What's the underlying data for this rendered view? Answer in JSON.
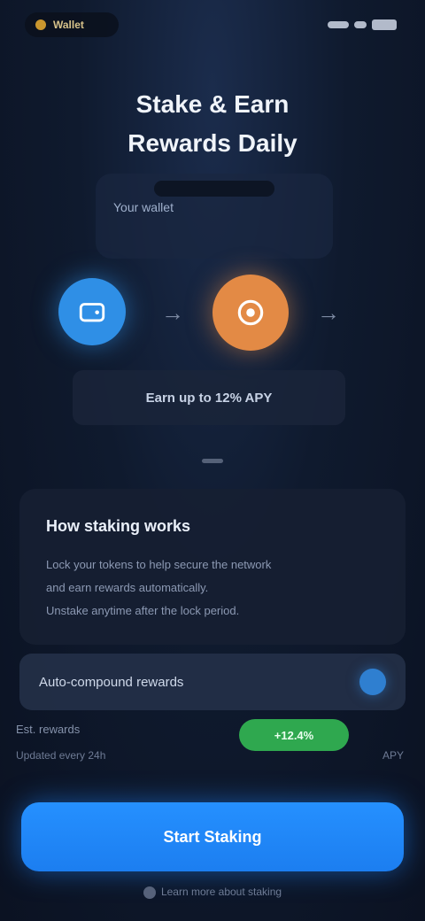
{
  "status_bar": {
    "brand": "Wallet"
  },
  "hero": {
    "title_line1": "Stake & Earn",
    "title_line2": "Rewards Daily"
  },
  "device": {
    "label": "Your wallet"
  },
  "flow": {
    "node_from_icon": "wallet-icon",
    "node_to_icon": "coin-icon",
    "arrow_glyph": "→"
  },
  "result": {
    "text": "Earn up to 12% APY"
  },
  "info_card": {
    "title": "How staking works",
    "line1": "Lock your tokens to help secure the network",
    "line2": "and earn rewards automatically.",
    "line3": "Unstake anytime after the lock period."
  },
  "option": {
    "label": "Auto-compound rewards"
  },
  "stats": {
    "left_label": "Est. rewards",
    "left_sub": "Updated every 24h",
    "pill": "+12.4%",
    "right_sub": "APY"
  },
  "cta": {
    "label": "Start Staking"
  },
  "footer": {
    "link": "Learn more about staking"
  },
  "colors": {
    "accent": "#2590ff",
    "success": "#2fa84f",
    "orange": "#e38a45"
  }
}
